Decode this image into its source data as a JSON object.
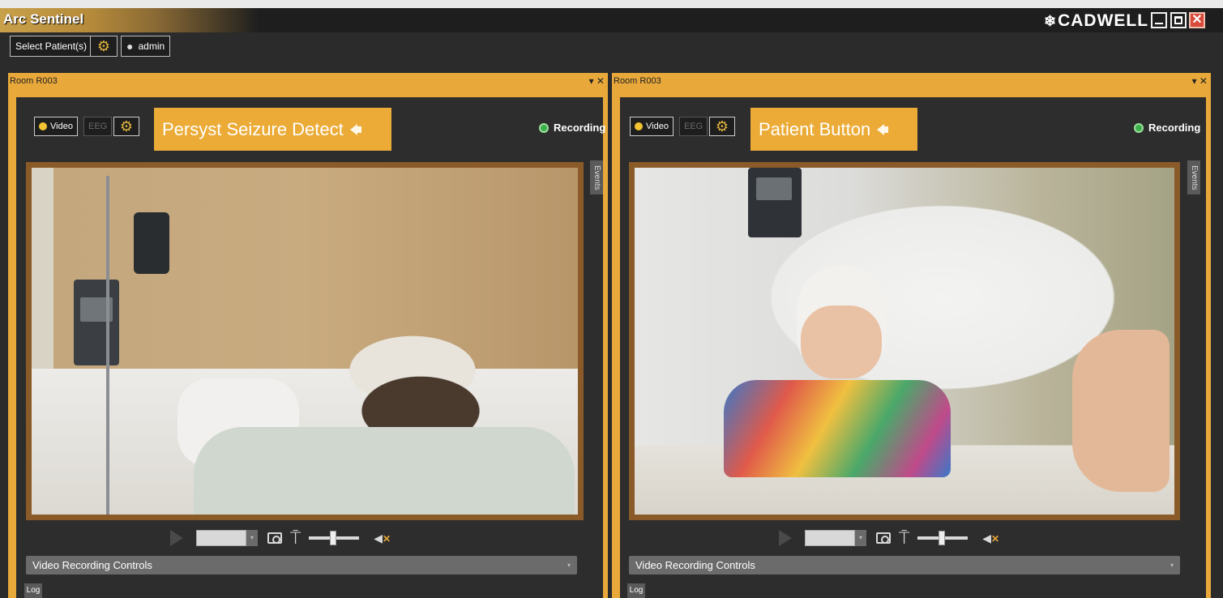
{
  "app": {
    "title": "Arc Sentinel",
    "brand": "CADWELL",
    "brand_mark": "❄",
    "window_controls": {
      "minimize": "",
      "maximize": "",
      "close": "✕"
    }
  },
  "toolbar": {
    "select_patients": "Select Patient(s)",
    "settings_icon": "gear-icon",
    "user_label": "admin",
    "user_icon": "person-icon"
  },
  "panels": [
    {
      "room": "Room R003",
      "controls": "▾ ✕",
      "mode_video": "Video",
      "mode_eeg": "EEG",
      "alert_text": "Persyst Seizure Detect",
      "recording": "Recording",
      "events_tab": "Events",
      "video_controls_label": "Video Recording Controls",
      "log_label": "Log"
    },
    {
      "room": "Room R003",
      "controls": "▾ ✕",
      "mode_video": "Video",
      "mode_eeg": "EEG",
      "alert_text": "Patient Button",
      "recording": "Recording",
      "events_tab": "Events",
      "video_controls_label": "Video Recording Controls",
      "log_label": "Log"
    }
  ],
  "colors": {
    "accent": "#e8a83a",
    "recording": "#3ab04a",
    "background": "#2b2b2b"
  }
}
